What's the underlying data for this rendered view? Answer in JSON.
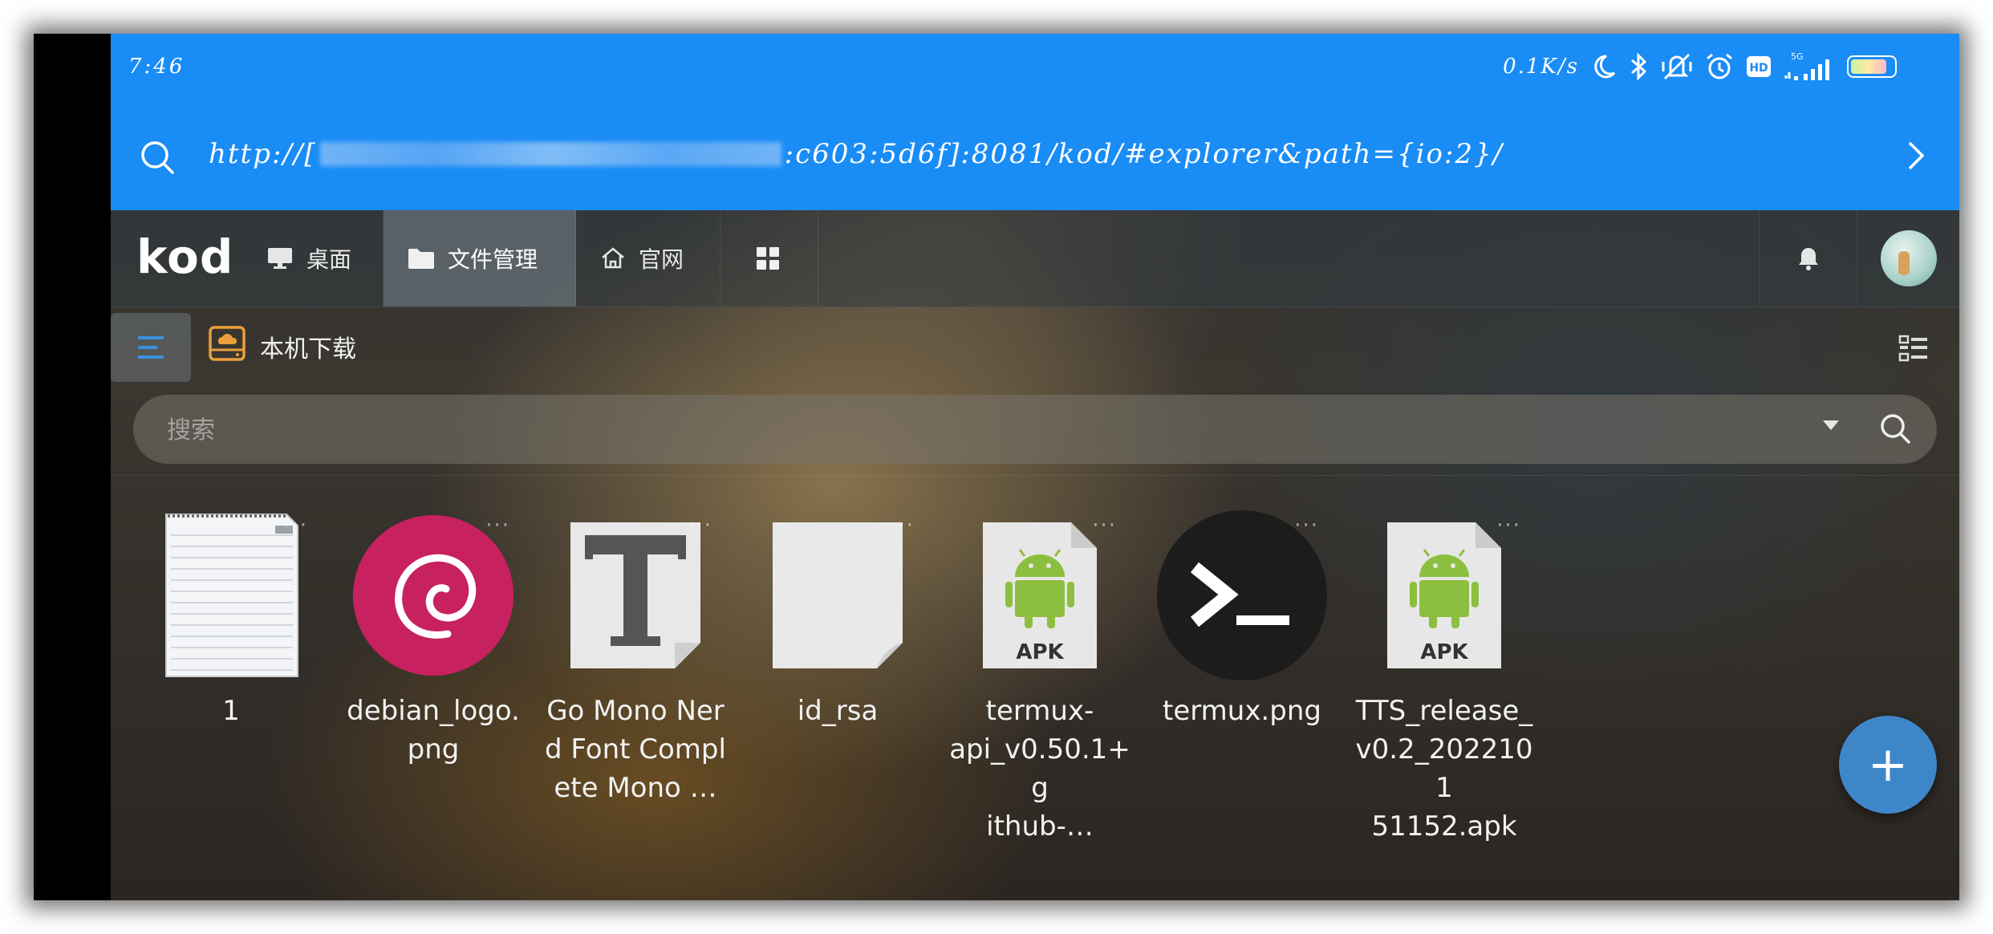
{
  "status_bar": {
    "time": "7:46",
    "net_speed": "0.1K/s",
    "icons": [
      "moon-icon",
      "bluetooth-icon",
      "vibrate-off-icon",
      "alarm-icon",
      "hd-icon",
      "signal-5g-icon",
      "battery-icon"
    ],
    "signal_label": "5G"
  },
  "address_bar": {
    "url_prefix": "http://[",
    "url_suffix": ":c603:5d6f]:8081/kod/#explorer&path={io:2}/"
  },
  "kod_nav": {
    "logo": "kod",
    "items": [
      {
        "label": "桌面",
        "icon": "monitor-icon"
      },
      {
        "label": "文件管理",
        "icon": "folder-icon",
        "active": true
      },
      {
        "label": "官网",
        "icon": "home-icon"
      },
      {
        "label": "",
        "icon": "apps-grid-icon"
      }
    ],
    "right_icons": [
      "bell-icon",
      "avatar"
    ]
  },
  "path_bar": {
    "location": "本机下载"
  },
  "search": {
    "placeholder": "搜索"
  },
  "files": [
    {
      "name": "1",
      "icon": "text-file-icon"
    },
    {
      "name": "debian_logo.\npng",
      "icon": "debian-logo-icon"
    },
    {
      "name": "Go Mono Ner\nd Font Compl\nete Mono …",
      "icon": "font-file-icon"
    },
    {
      "name": "id_rsa",
      "icon": "blank-file-icon"
    },
    {
      "name": "termux-\napi_v0.50.1+g\nithub-…",
      "icon": "apk-file-icon"
    },
    {
      "name": "termux.png",
      "icon": "terminal-icon"
    },
    {
      "name": "TTS_release_\nv0.2_2022101\n51152.apk",
      "icon": "apk-file-icon"
    }
  ],
  "apk_badge": "APK",
  "file_more": "···",
  "fab": {
    "label": "+"
  }
}
